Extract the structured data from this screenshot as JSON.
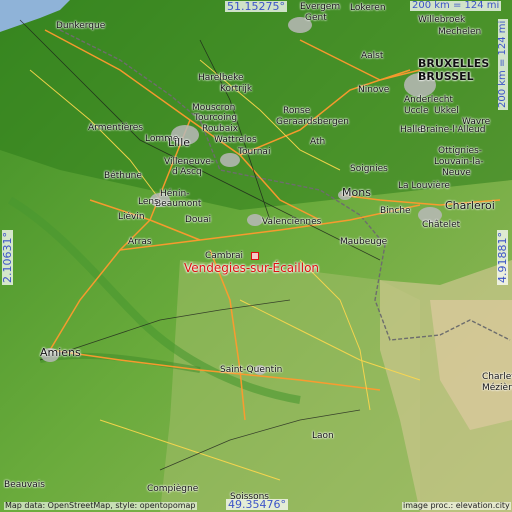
{
  "map": {
    "coords": {
      "top_lat": "51.15275°",
      "bottom_lat": "49.35476°",
      "left_lon": "2.10631°",
      "right_lon": "4.91881°",
      "scale_top": "200 km = 124 mi",
      "scale_right": "200 km = 124 mi"
    },
    "highlight": {
      "name": "Vendegies-sur-Écaillon"
    },
    "cities": [
      "Dunkerque",
      "Gent",
      "Lokeren",
      "Evergem",
      "Willebroek",
      "Mechelen",
      "BRUXELLES",
      "BRUSSEL",
      "Aalst",
      "Ninove",
      "Anderlecht",
      "Uccle",
      "Ukkel",
      "Halle",
      "Wavre",
      "Braine-l'Alleud",
      "Ottignies-",
      "Louvain-la-",
      "Neuve",
      "Harelbeke",
      "Kortrijk",
      "Mouscron",
      "Tourcoing",
      "Roubaix",
      "Wattrelos",
      "Ronse",
      "Geraardsbergen",
      "Armentières",
      "Lomme",
      "Lille",
      "Villeneuve-",
      "d'Ascq",
      "Tournai",
      "Ath",
      "Soignies",
      "La Louvière",
      "Béthune",
      "Hénin-",
      "Beaumont",
      "Mons",
      "Lens",
      "Douai",
      "Valenciennes",
      "Binche",
      "Charleroi",
      "Châtelet",
      "Liévin",
      "Arras",
      "Maubeuge",
      "Cambrai",
      "Amiens",
      "Saint-Quentin",
      "Charlev",
      "Mézière",
      "Laon",
      "Beauvais",
      "Compiègne",
      "Soissons"
    ],
    "credits": {
      "left": "Map data: OpenStreetMap, style: opentopomap",
      "right": "image proc.: elevation.city"
    }
  }
}
